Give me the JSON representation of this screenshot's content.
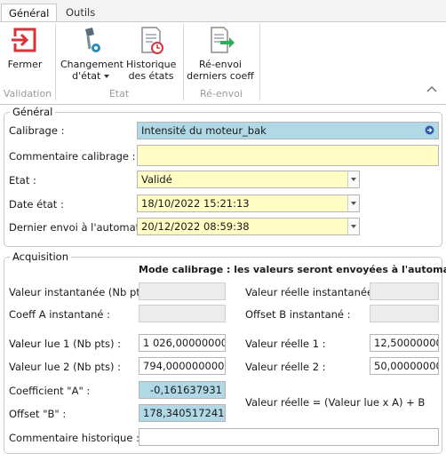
{
  "ribbon": {
    "tabs": [
      {
        "label": "Général"
      },
      {
        "label": "Outils"
      }
    ],
    "groups": [
      {
        "label": "Validation",
        "buttons": [
          {
            "label": "Fermer",
            "icon": "exit-icon"
          }
        ]
      },
      {
        "label": "Etat",
        "buttons": [
          {
            "label": "Changement\nd'état",
            "icon": "change-state-icon",
            "has_dropdown": true
          },
          {
            "label": "Historique\ndes états",
            "icon": "history-icon"
          }
        ]
      },
      {
        "label": "Ré-envoi",
        "buttons": [
          {
            "label": "Ré-envoi\nderniers coeff",
            "icon": "resend-icon"
          }
        ]
      }
    ]
  },
  "general": {
    "title": "Général",
    "calibrage_label": "Calibrage :",
    "calibrage_value": "Intensité du moteur_bak",
    "commentaire_calibrage_label": "Commentaire calibrage :",
    "commentaire_calibrage_value": "",
    "etat_label": "Etat :",
    "etat_value": "Validé",
    "date_etat_label": "Date état :",
    "date_etat_value": "18/10/2022  15:21:13",
    "dernier_envoi_label": "Dernier envoi à l'automate :",
    "dernier_envoi_value": "20/12/2022  08:59:38"
  },
  "acquisition": {
    "title": "Acquisition",
    "mode_text": "Mode calibrage : les valeurs seront envoyées à l'automate",
    "valeur_instantanee_label": "Valeur instantanée (Nb pts) :",
    "valeur_instantanee_value": "",
    "valeur_reelle_instantanee_label": "Valeur réelle instantanée :",
    "valeur_reelle_instantanee_value": "",
    "coeff_a_instantane_label": "Coeff A instantané :",
    "coeff_a_instantane_value": "",
    "offset_b_instantane_label": "Offset B instantané :",
    "offset_b_instantane_value": "",
    "valeur_lue_1_label": "Valeur lue 1 (Nb pts) :",
    "valeur_lue_1_value": "1 026,000000000",
    "valeur_reelle_1_label": "Valeur réelle 1 :",
    "valeur_reelle_1_value": "12,500000000",
    "valeur_lue_2_label": "Valeur lue 2 (Nb pts) :",
    "valeur_lue_2_value": "794,000000000",
    "valeur_reelle_2_label": "Valeur réelle 2 :",
    "valeur_reelle_2_value": "50,000000000",
    "coefficient_a_label": "Coefficient \"A\" :",
    "coefficient_a_value": "-0,161637931",
    "offset_b_label": "Offset \"B\" :",
    "offset_b_value": "178,340517241",
    "formula_text": "Valeur réelle = (Valeur lue x A) + B",
    "commentaire_historique_label": "Commentaire historique :",
    "commentaire_historique_value": ""
  },
  "colors": {
    "required_field": "#fffdc4",
    "computed_field": "#b0d8e6",
    "disabled_field": "#ececec",
    "exit_icon": "#d9333a",
    "resend_arrow": "#2fae5a"
  }
}
